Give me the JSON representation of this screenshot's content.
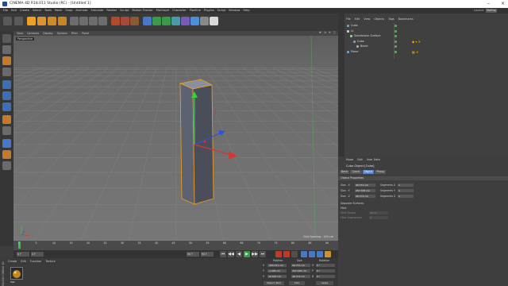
{
  "window": {
    "title": "CINEMA 4D R18.011 Studio (RC) - [Untitled 1]",
    "minimize": "–",
    "close": "×"
  },
  "menubar": {
    "items": [
      "File",
      "Edit",
      "Create",
      "Select",
      "Tools",
      "Mesh",
      "Snap",
      "Animate",
      "Simulate",
      "Render",
      "Sculpt",
      "Motion Tracker",
      "MoGraph",
      "Character",
      "Pipeline",
      "Plugins",
      "Script",
      "Window",
      "Help"
    ],
    "layout_label": "Layout:",
    "layout_value": "Startup"
  },
  "toolbar": {
    "colors": {
      "accent": "#f0a020",
      "blue": "#4a78c8",
      "green": "#3a9a4a",
      "red": "#c0392b"
    }
  },
  "viewport": {
    "menu": [
      "View",
      "Cameras",
      "Display",
      "Options",
      "Filter",
      "Panel"
    ],
    "label": "Perspective",
    "grid_spacing": "Grid Spacing : 100 cm",
    "nav_icons": "✥ ⇲ ⟳ ▢"
  },
  "timeline": {
    "ruler": [
      "0",
      "5",
      "10",
      "15",
      "20",
      "25",
      "30",
      "35",
      "40",
      "45",
      "50",
      "55",
      "60",
      "65",
      "70",
      "75",
      "80",
      "85",
      "90"
    ],
    "current_frame": "0 F",
    "start_frame": "0 F",
    "end_frame": "90 F",
    "end_frame2": "90 F",
    "play_buttons": [
      "⏮",
      "◀◀",
      "◀",
      "▶",
      "▶▶",
      "⏭"
    ]
  },
  "materials": {
    "menu": [
      "Create",
      "Edit",
      "Function",
      "Texture"
    ],
    "material_name": "Mat",
    "side_logo": "MAXON CINEMA 4D"
  },
  "coordinates": {
    "headers": [
      "Position",
      "Size",
      "Rotation"
    ],
    "rows": [
      {
        "axis": "X",
        "pos": "-200.211 cm",
        "size": "40.774 cm",
        "rot_label": "H",
        "rot": "0 °"
      },
      {
        "axis": "Y",
        "pos": "-1.395 cm",
        "size": "257.305 cm",
        "rot_label": "P",
        "rot": "0 °"
      },
      {
        "axis": "Z",
        "pos": "49.597 cm",
        "size": "40.774 cm",
        "rot_label": "B",
        "rot": "0 °"
      }
    ],
    "mode": "Object (Rel)",
    "size_mode": "Size",
    "apply": "Apply"
  },
  "objects": {
    "menu": [
      "File",
      "Edit",
      "View",
      "Objects",
      "Tags",
      "Bookmarks"
    ],
    "items": [
      {
        "name": "Cube",
        "indent": 0,
        "icon": "cube-icon",
        "color": "#5fa6e6"
      },
      {
        "name": "Lt",
        "indent": 0,
        "icon": "light-icon",
        "color": "#cfcfcf"
      },
      {
        "name": "Subdivision Surface",
        "indent": 1,
        "icon": "subdiv-icon",
        "color": "#8fd18f"
      },
      {
        "name": "Cube",
        "indent": 2,
        "icon": "cube-icon",
        "color": "#5fa6e6"
      },
      {
        "name": "Bevel",
        "indent": 3,
        "icon": "bevel-icon",
        "color": "#c88fd8"
      },
      {
        "name": "Plane",
        "indent": 0,
        "icon": "plane-icon",
        "color": "#5fa6e6"
      }
    ]
  },
  "attributes": {
    "menu": [
      "Mode",
      "Edit",
      "User Data"
    ],
    "title": "Cube Object [Cube]",
    "tabs": [
      "Basic",
      "Coord.",
      "Object",
      "Phong"
    ],
    "active_tab": "Object",
    "section": "Object Properties",
    "props": [
      {
        "label": "Size . X",
        "value": "40.774 cm",
        "seg_label": "Segments X",
        "seg": "1"
      },
      {
        "label": "Size . Y",
        "value": "257.305 cm",
        "seg_label": "Segments Y",
        "seg": "1"
      },
      {
        "label": "Size . Z",
        "value": "40.774 cm",
        "seg_label": "Segments Z",
        "seg": "1"
      }
    ],
    "separate_surfaces": "Separate Surfaces",
    "fillet": "Fillet",
    "fillet_radius": "Fillet Radius",
    "fillet_radius_val": "40 cm",
    "fillet_subdivision": "Fillet Subdivision",
    "fillet_subdivision_val": "5"
  }
}
